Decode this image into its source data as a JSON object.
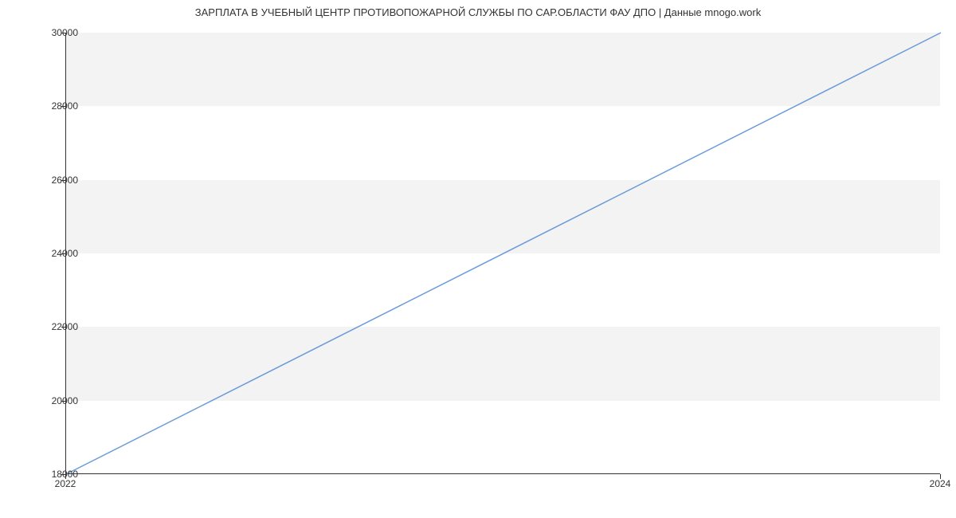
{
  "chart_data": {
    "type": "line",
    "title": "ЗАРПЛАТА В УЧЕБНЫЙ ЦЕНТР ПРОТИВОПОЖАРНОЙ СЛУЖБЫ ПО САР.ОБЛАСТИ ФАУ ДПО | Данные mnogo.work",
    "xlabel": "",
    "ylabel": "",
    "x": [
      2022,
      2024
    ],
    "values": [
      18000,
      30000
    ],
    "ylim": [
      18000,
      30000
    ],
    "y_ticks": [
      18000,
      20000,
      22000,
      24000,
      26000,
      28000,
      30000
    ],
    "x_ticks": [
      2022,
      2024
    ],
    "line_color": "#6b9bd8",
    "band_color": "#f3f3f3"
  }
}
